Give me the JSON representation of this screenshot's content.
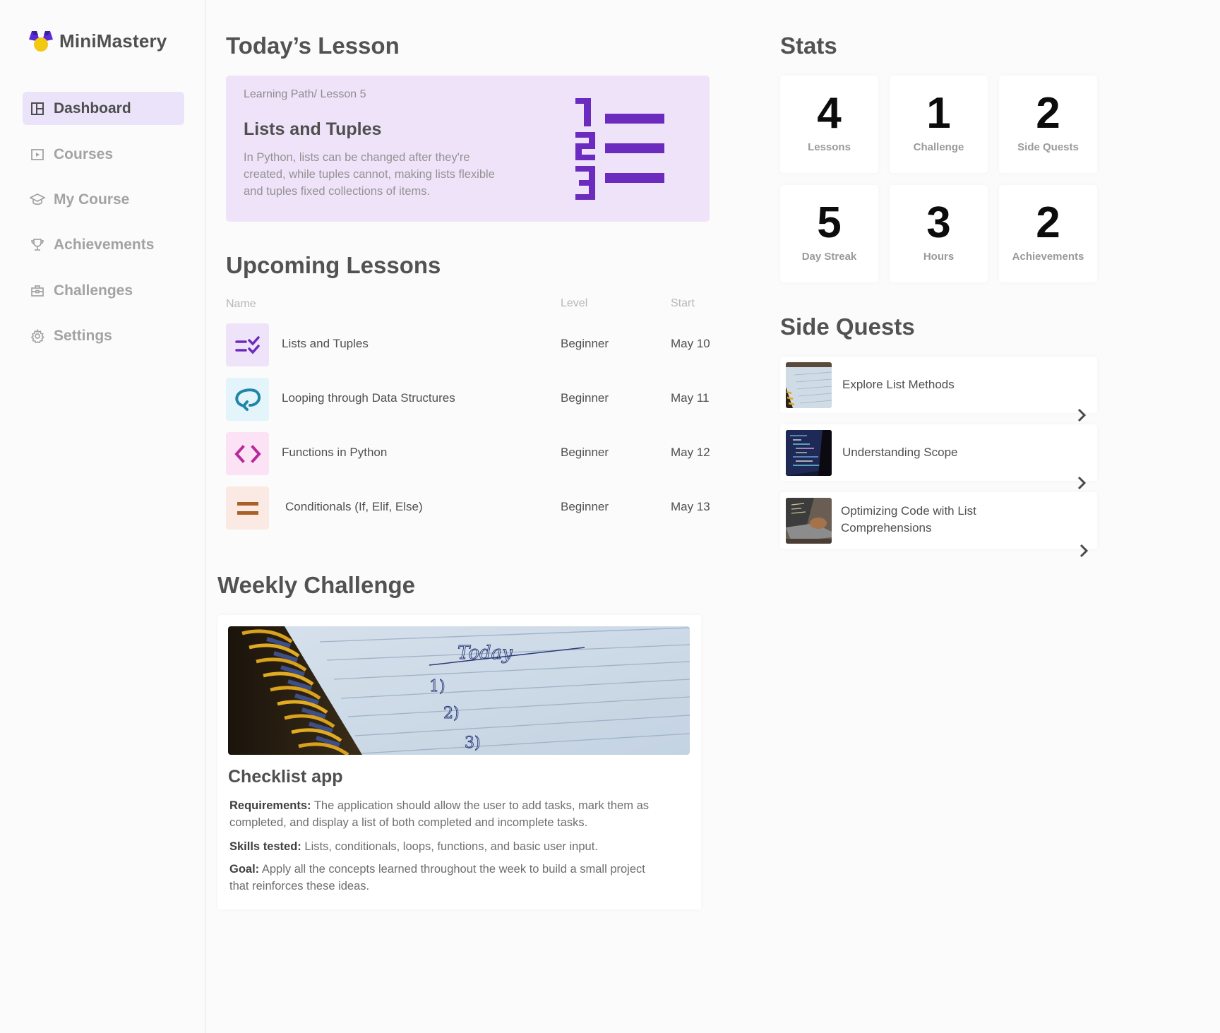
{
  "brand": {
    "name": "MiniMastery",
    "logo_icon": "medal-logo-icon"
  },
  "sidebar": {
    "items": [
      {
        "label": "Dashboard",
        "icon": "layout-icon",
        "active": true
      },
      {
        "label": "Courses",
        "icon": "play-square-icon",
        "active": false
      },
      {
        "label": "My Course",
        "icon": "graduation-cap-icon",
        "active": false
      },
      {
        "label": "Achievements",
        "icon": "trophy-icon",
        "active": false
      },
      {
        "label": "Challenges",
        "icon": "briefcase-icon",
        "active": false
      },
      {
        "label": "Settings",
        "icon": "gear-icon",
        "active": false
      }
    ]
  },
  "today": {
    "heading": "Today’s Lesson",
    "path": "Learning Path/ Lesson 5",
    "title": "Lists and Tuples",
    "description": "In Python, lists can be changed after they're created, while tuples cannot, making lists flexible and tuples fixed collections of items.",
    "art_icon": "numbered-list-icon",
    "accent": "#6b2bbf",
    "bg": "#efe3fa"
  },
  "upcoming": {
    "heading": "Upcoming Lessons",
    "columns": {
      "name": "Name",
      "level": "Level",
      "start": "Start"
    },
    "rows": [
      {
        "name": "Lists and Tuples",
        "level": "Beginner",
        "start": "May 10",
        "icon": "list-check-icon",
        "icon_bg": "#efe3fa",
        "icon_color": "#6b2bbf"
      },
      {
        "name": "Looping through Data Structures",
        "level": "Beginner",
        "start": "May 11",
        "icon": "loop-arrow-icon",
        "icon_bg": "#e3f5fb",
        "icon_color": "#1f86a8"
      },
      {
        "name": "Functions in Python",
        "level": "Beginner",
        "start": "May 12",
        "icon": "code-brackets-icon",
        "icon_bg": "#fbe3f5",
        "icon_color": "#b82a9c"
      },
      {
        "name": "Conditionals (If, Elif, Else)",
        "level": "Beginner",
        "start": "May 13",
        "icon": "equals-icon",
        "icon_bg": "#fbe9e3",
        "icon_color": "#a86026"
      }
    ]
  },
  "weekly": {
    "heading": "Weekly Challenge",
    "image_icon": "notebook-today-image",
    "title": "Checklist app",
    "requirements_label": "Requirements:",
    "requirements": "The application should allow the user to add tasks, mark them as completed, and display a list of both completed and incomplete tasks.",
    "skills_label": "Skills tested:",
    "skills": "Lists, conditionals, loops, functions, and basic user input.",
    "goal_label": "Goal:",
    "goal": "Apply all the concepts learned throughout the week to build a small project that reinforces these ideas."
  },
  "stats": {
    "heading": "Stats",
    "items": [
      {
        "value": "4",
        "label": "Lessons"
      },
      {
        "value": "1",
        "label": "Challenge"
      },
      {
        "value": "2",
        "label": "Side Quests"
      },
      {
        "value": "5",
        "label": "Day Streak"
      },
      {
        "value": "3",
        "label": "Hours"
      },
      {
        "value": "2",
        "label": "Achievements"
      }
    ]
  },
  "side_quests": {
    "heading": "Side Quests",
    "items": [
      {
        "title": "Explore List Methods",
        "thumb": "notebook-thumbnail"
      },
      {
        "title": "Understanding Scope",
        "thumb": "code-screen-thumbnail"
      },
      {
        "title": "Optimizing Code with List Comprehensions",
        "thumb": "laptop-typing-thumbnail"
      }
    ]
  }
}
